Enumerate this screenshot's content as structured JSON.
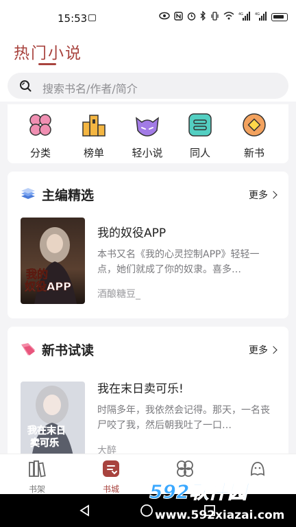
{
  "status": {
    "time": "15:53",
    "signal_labels": [
      "4G",
      "4G"
    ]
  },
  "header": {
    "title": "热门小说",
    "search_placeholder": "搜索书名/作者/简介"
  },
  "categories": [
    {
      "label": "分类",
      "icon": "clover-icon",
      "color": "#f08fb2"
    },
    {
      "label": "榜单",
      "icon": "ranking-icon",
      "color": "#f4b642"
    },
    {
      "label": "轻小说",
      "icon": "bat-icon",
      "color": "#a27be6"
    },
    {
      "label": "同人",
      "icon": "list-icon",
      "color": "#53cfc2"
    },
    {
      "label": "新书",
      "icon": "new-book-icon",
      "color": "#f3a25e"
    }
  ],
  "editor_pick": {
    "title": "主编精选",
    "more": "更多",
    "book": {
      "title": "我的奴役APP",
      "desc": "本书又名《我的心灵控制APP》轻轻一点，她们就成了你的奴隶。喜多…",
      "author": "酒酿糖豆_",
      "cover_text": "我的奴役APP"
    }
  },
  "new_books": {
    "title": "新书试读",
    "more": "更多",
    "book": {
      "title": "我在末日卖可乐!",
      "desc": "时隔多年，我依然会记得。那天，一名丧尸咬了我，然后朝我吐了一口…",
      "author": "大醉",
      "cover_text": "我在末日卖可乐"
    }
  },
  "tabbar": [
    {
      "label": "书架",
      "icon": "bookshelf-icon",
      "active": false
    },
    {
      "label": "书城",
      "icon": "bookstore-icon",
      "active": true
    },
    {
      "label": "",
      "icon": "discover-icon",
      "active": false
    },
    {
      "label": "",
      "icon": "profile-icon",
      "active": false
    }
  ],
  "watermark": {
    "text_main": "592软件园",
    "text_url": "www.592xiazai.com"
  },
  "colors": {
    "accent": "#a8433e",
    "background": "#f4f4f6"
  }
}
